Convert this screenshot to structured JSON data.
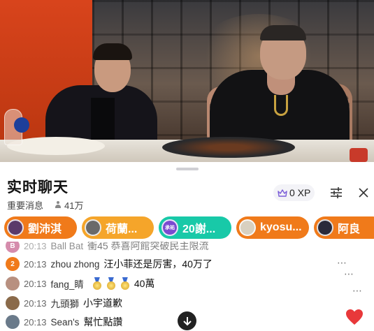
{
  "panel": {
    "title": "实时聊天",
    "subtitle": "重要消息",
    "viewer_count": "41万",
    "xp_label": "0 XP"
  },
  "gifts": [
    {
      "name": "劉沛淇",
      "color": "#f07a1a",
      "avatar_color": "#5a3a6a"
    },
    {
      "name": "荷蘭...",
      "color": "#f5a52a",
      "avatar_color": "#6a6a6a"
    },
    {
      "name": "20謝...",
      "color": "#18c9a8",
      "avatar_color": "#7a4ad0",
      "avatar_text": "承祐"
    },
    {
      "name": "kyosu...",
      "color": "#f07a1a",
      "avatar_color": "#d8d0c0"
    },
    {
      "name": "阿良",
      "color": "#f07a1a",
      "avatar_color": "#2a2a3a"
    }
  ],
  "messages": [
    {
      "avatar_text": "B",
      "avatar_color": "#b4306a",
      "time": "20:13",
      "user": "Ball Bat",
      "text": "衝45 恭喜阿館突破民主限流",
      "partial": true
    },
    {
      "avatar_text": "2",
      "avatar_color": "#f07a1a",
      "time": "20:13",
      "user": "zhou zhong",
      "text": "汪小菲还是厉害，40万了"
    },
    {
      "avatar_text": "",
      "avatar_color": "#b89080",
      "time": "20:13",
      "user": "fang_睛",
      "text": "40萬",
      "medals": 3
    },
    {
      "avatar_text": "",
      "avatar_color": "#8a6a4a",
      "time": "20:13",
      "user": "九頭獅",
      "text": "小宇道歉"
    },
    {
      "avatar_text": "",
      "avatar_color": "#6a7a8a",
      "time": "20:13",
      "user": "Sean's",
      "text": "幫忙點讚"
    }
  ],
  "icons": {
    "crown": "crown-icon",
    "settings": "sliders-icon",
    "close": "close-icon",
    "scroll": "arrow-down-icon",
    "heart": "heart-icon",
    "more": "more-dots-icon"
  },
  "colors": {
    "heart": "#e8383a",
    "orange": "#f07a1a",
    "teal": "#18c9a8"
  }
}
